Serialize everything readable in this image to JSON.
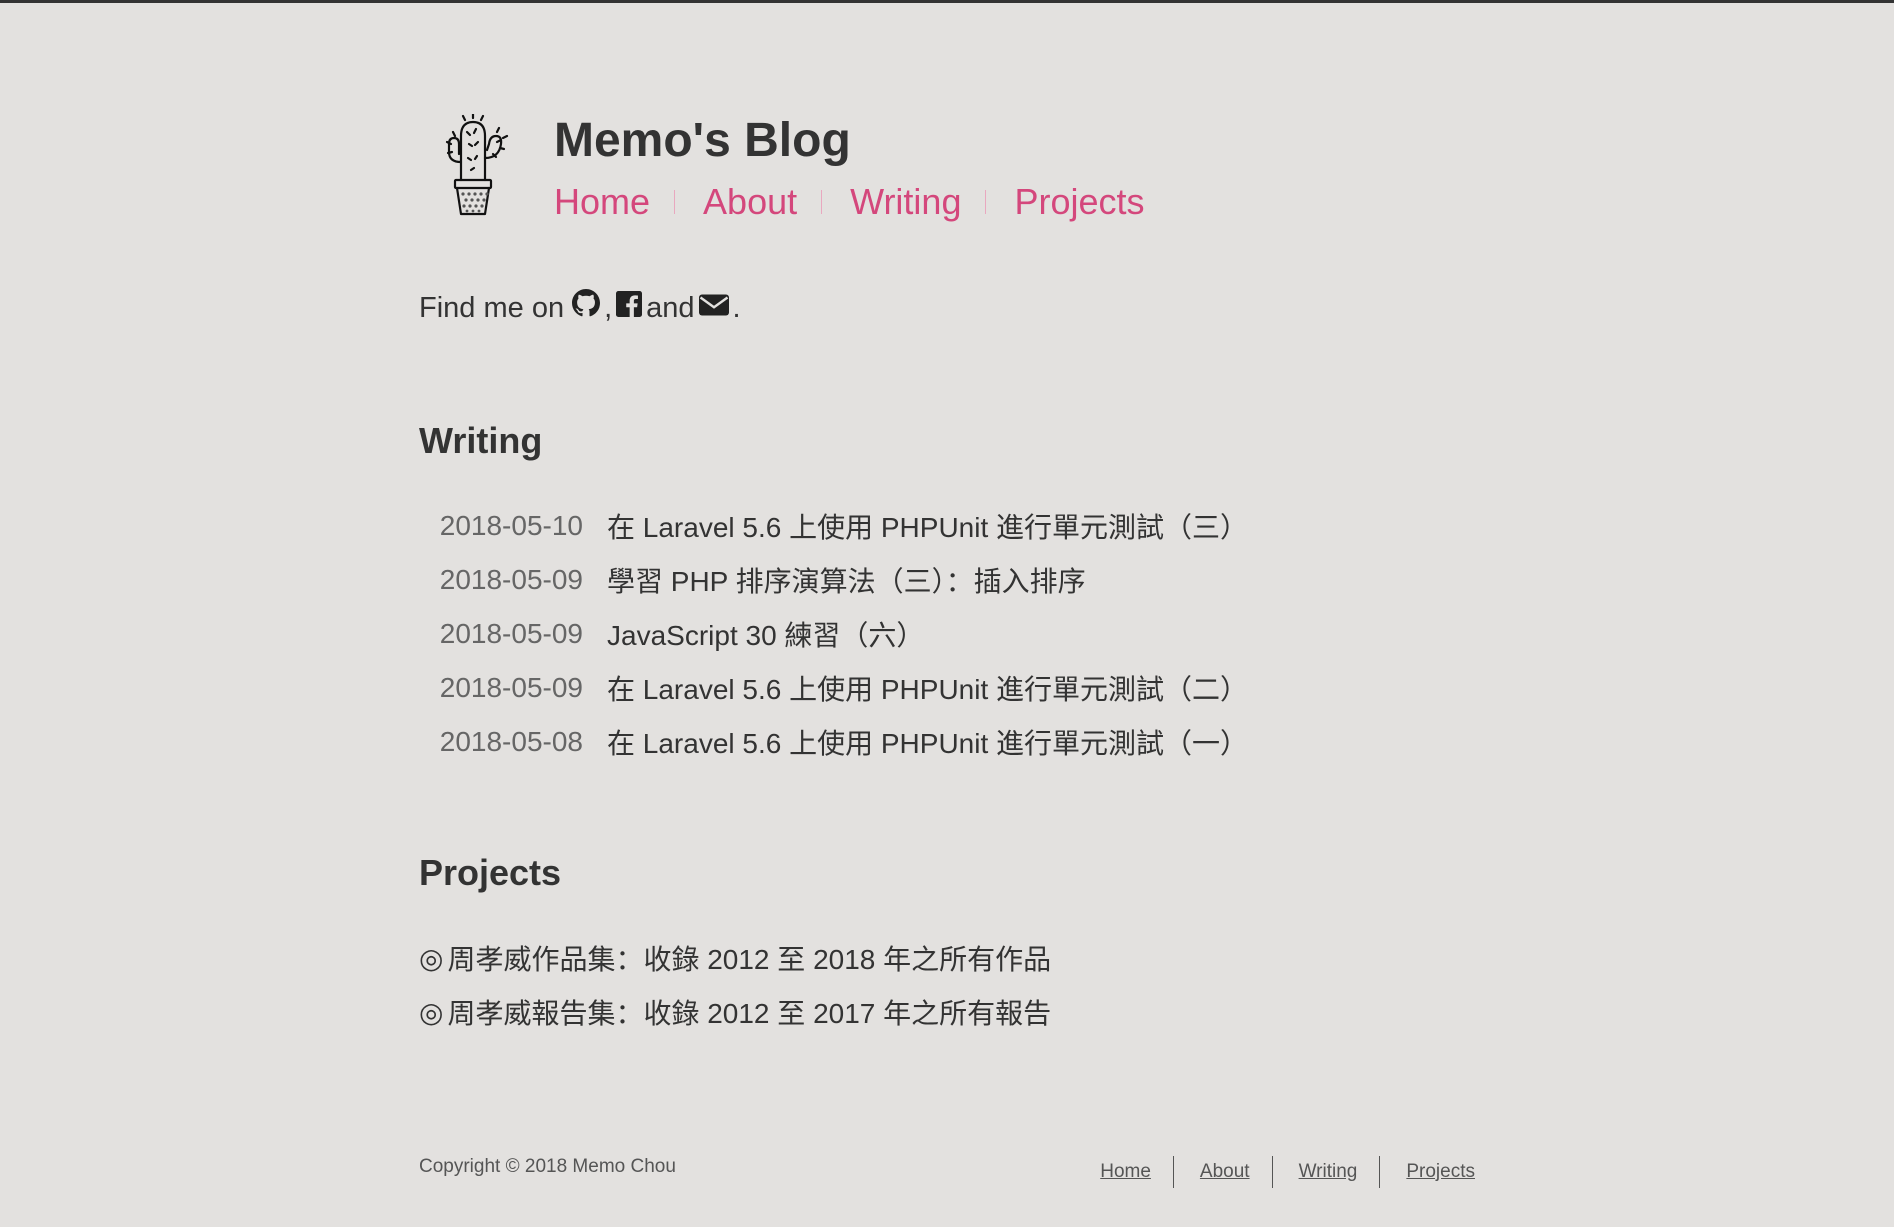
{
  "header": {
    "title": "Memo's Blog",
    "nav": [
      {
        "label": "Home"
      },
      {
        "label": "About"
      },
      {
        "label": "Writing"
      },
      {
        "label": "Projects"
      }
    ]
  },
  "find_me": {
    "prefix": "Find me on",
    "comma": ",",
    "and": "and",
    "period": ".",
    "icons": [
      "github-icon",
      "facebook-icon",
      "envelope-icon"
    ]
  },
  "writing": {
    "title": "Writing",
    "posts": [
      {
        "date": "2018-05-10",
        "title": "在 Laravel 5.6 上使用 PHPUnit 進行單元測試（三）"
      },
      {
        "date": "2018-05-09",
        "title": "學習 PHP 排序演算法（三）：插入排序"
      },
      {
        "date": "2018-05-09",
        "title": "JavaScript 30 練習（六）"
      },
      {
        "date": "2018-05-09",
        "title": "在 Laravel 5.6 上使用 PHPUnit 進行單元測試（二）"
      },
      {
        "date": "2018-05-08",
        "title": "在 Laravel 5.6 上使用 PHPUnit 進行單元測試（一）"
      }
    ]
  },
  "projects": {
    "title": "Projects",
    "bullet": "◎",
    "items": [
      {
        "label": "周孝威作品集：收錄 2012 至 2018 年之所有作品"
      },
      {
        "label": "周孝威報告集：收錄 2012 至 2017 年之所有報告"
      }
    ]
  },
  "footer": {
    "copyright": "Copyright © 2018 Memo Chou",
    "nav": [
      {
        "label": "Home"
      },
      {
        "label": "About"
      },
      {
        "label": "Writing"
      },
      {
        "label": "Projects"
      }
    ]
  },
  "colors": {
    "background": "#e3e1df",
    "text": "#333333",
    "accent": "#d4477c",
    "muted": "#666666"
  }
}
